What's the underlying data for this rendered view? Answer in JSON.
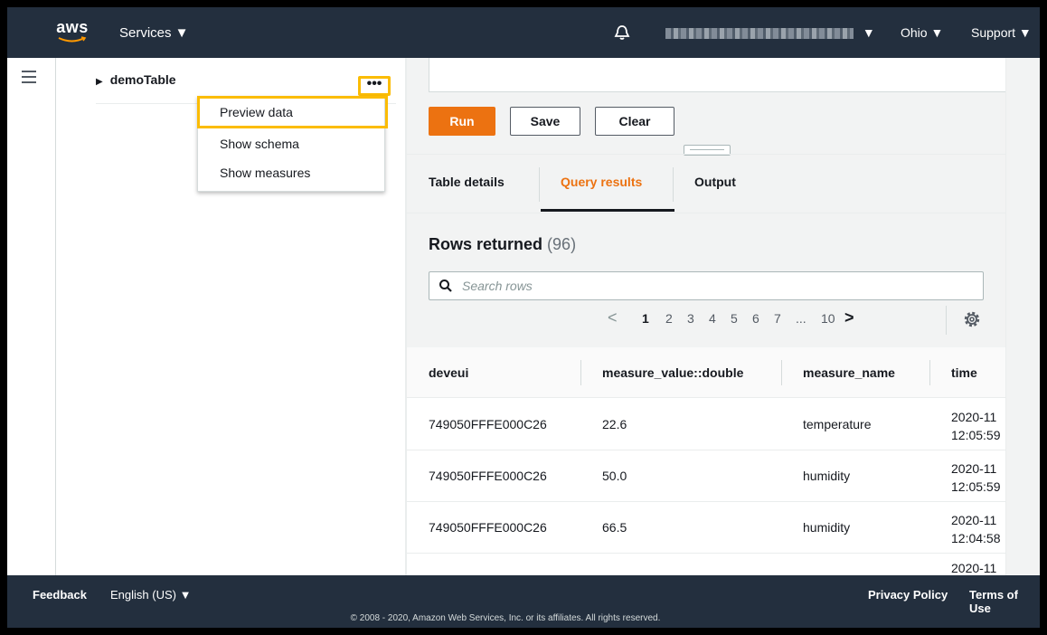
{
  "topbar": {
    "logo_text": "aws",
    "services_label": "Services ▼",
    "account_caret": "▼",
    "region_label": "Ohio ▼",
    "support_label": "Support ▼"
  },
  "tree": {
    "table_name": "demoTable",
    "more_label": "•••",
    "menu_items": [
      "Preview data",
      "Show schema",
      "Show measures"
    ]
  },
  "toolbar": {
    "run_label": "Run",
    "save_label": "Save",
    "clear_label": "Clear"
  },
  "tabs": [
    "Table details",
    "Query results",
    "Output"
  ],
  "results": {
    "title": "Rows returned",
    "count": "(96)",
    "search_placeholder": "Search rows",
    "pages": [
      "1",
      "2",
      "3",
      "4",
      "5",
      "6",
      "7",
      "...",
      "10"
    ],
    "columns": [
      "deveui",
      "measure_value::double",
      "measure_name",
      "time"
    ],
    "rows": [
      {
        "deveui": "749050FFFE000C26",
        "value": "22.6",
        "name": "temperature",
        "time": "2020-11 12:05:59"
      },
      {
        "deveui": "749050FFFE000C26",
        "value": "50.0",
        "name": "humidity",
        "time": "2020-11 12:05:59"
      },
      {
        "deveui": "749050FFFE000C26",
        "value": "66.5",
        "name": "humidity",
        "time": "2020-11 12:04:58"
      },
      {
        "deveui": "",
        "value": "",
        "name": "",
        "time": "2020-11"
      }
    ]
  },
  "footer": {
    "feedback": "Feedback",
    "language": "English (US) ▼",
    "privacy": "Privacy Policy",
    "terms": "Terms of Use",
    "copyright": "© 2008 - 2020, Amazon Web Services, Inc. or its affiliates. All rights reserved."
  },
  "colors": {
    "nav_bg": "#232f3e",
    "accent": "#ec7211",
    "highlight": "#fbbc04"
  }
}
